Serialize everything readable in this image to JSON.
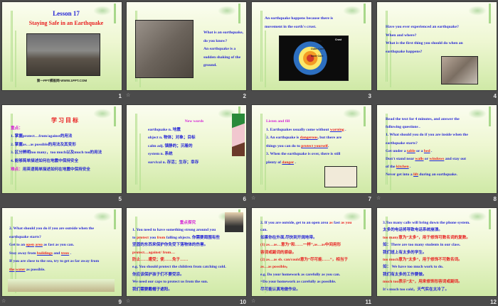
{
  "colors": {
    "blue": "#2626d6",
    "red": "#e82020",
    "magenta": "#d424d4",
    "dark": "#222222"
  },
  "slides": [
    {
      "number": "1",
      "lines": [
        {
          "align": "center",
          "size": 9,
          "segs": [
            {
              "t": "Lesson 17",
              "c": "blue"
            }
          ]
        },
        {
          "align": "center",
          "size": 8,
          "segs": [
            {
              "t": "Staying Safe  in an Earthquake",
              "c": "red"
            }
          ]
        }
      ],
      "footer": "第一PPT模板网-WWW.1PPT.COM",
      "image": "earthquake-ruins"
    },
    {
      "number": "2",
      "anim": true,
      "lines": [
        {
          "segs": [
            {
              "t": "What is an earthquake,",
              "c": "blue"
            }
          ]
        },
        {
          "segs": [
            {
              "t": "do you know?",
              "c": "blue"
            }
          ]
        },
        {
          "segs": [
            {
              "t": "An earthquake is a",
              "c": "blue"
            }
          ]
        },
        {
          "segs": [
            {
              "t": "sudden shaking of the",
              "c": "blue"
            }
          ]
        },
        {
          "segs": [
            {
              "t": "ground.",
              "c": "blue"
            }
          ]
        }
      ],
      "image": "collapsed-street"
    },
    {
      "number": "3",
      "lines": [
        {
          "segs": [
            {
              "t": "An earthquake happens because there is",
              "c": "blue"
            }
          ]
        },
        {
          "segs": [
            {
              "t": "movement in the earth's crust.",
              "c": "blue"
            }
          ]
        }
      ],
      "image": "earth-layers",
      "diagram_labels": [
        "Mantle",
        "Crust",
        "Outer Core",
        "Inner Core"
      ]
    },
    {
      "number": "4",
      "lines": [
        {
          "segs": [
            {
              "t": "Have you ever experienced an earthquake?",
              "c": "blue"
            }
          ]
        },
        {
          "segs": [
            {
              "t": "When and where?",
              "c": "blue"
            }
          ]
        },
        {
          "segs": [
            {
              "t": "What is the first thing you should do when an",
              "c": "blue"
            }
          ]
        },
        {
          "segs": [
            {
              "t": "earthquake happens?",
              "c": "blue"
            }
          ]
        }
      ],
      "image": "rescue-photo"
    },
    {
      "number": "5",
      "lines": [
        {
          "align": "center",
          "size": 8,
          "segs": [
            {
              "t": "学 习 目 标",
              "c": "red"
            }
          ]
        },
        {
          "segs": [
            {
              "t": "重点：",
              "c": "magenta"
            }
          ]
        },
        {
          "segs": [
            {
              "t": "1. 掌握protect…from/against的用法",
              "c": "blue"
            }
          ]
        },
        {
          "segs": [
            {
              "t": "2. 掌握as…as possible的用法及其变形",
              "c": "blue"
            }
          ]
        },
        {
          "segs": [
            {
              "t": "3. 区分辨明too many，too much以及much too的用法",
              "c": "blue"
            }
          ]
        },
        {
          "segs": [
            {
              "t": "4. 能够简单描述如何在地震中保持安全",
              "c": "blue"
            }
          ]
        },
        {
          "segs": [
            {
              "t": "难点：",
              "c": "magenta"
            },
            {
              "t": "用英语简单描述如何在地震中保持安全",
              "c": "blue"
            }
          ]
        }
      ]
    },
    {
      "number": "6",
      "lines": [
        {
          "align": "center",
          "segs": [
            {
              "t": "New  words",
              "c": "magenta"
            }
          ]
        },
        {
          "segs": [
            {
              "t": "earthquake                 n. 地震",
              "c": "blue"
            }
          ]
        },
        {
          "segs": [
            {
              "t": "object                  n. 物体；对象；目标",
              "c": "blue"
            }
          ]
        },
        {
          "segs": [
            {
              "t": "calm                    adj. 镇静的；沉着的",
              "c": "blue"
            }
          ]
        },
        {
          "segs": [
            {
              "t": "system                  n. 系统",
              "c": "blue"
            }
          ]
        },
        {
          "segs": [
            {
              "t": "survival                n. 存活；生存；幸存",
              "c": "blue"
            }
          ]
        }
      ],
      "image": "bird-branch"
    },
    {
      "number": "7",
      "anim": true,
      "lines": [
        {
          "segs": [
            {
              "t": "Listen  and  fill",
              "c": "magenta"
            }
          ]
        },
        {
          "segs": [
            {
              "t": "1. Earthquakes usually come without ",
              "c": "blue"
            },
            {
              "t": "warning",
              "c": "red",
              "u": true
            },
            {
              "t": " .",
              "c": "blue"
            }
          ]
        },
        {
          "segs": [
            {
              "t": "2. An earthquake is ",
              "c": "blue"
            },
            {
              "t": "dangerous",
              "c": "red",
              "u": true
            },
            {
              "t": ", but there are",
              "c": "blue"
            }
          ]
        },
        {
          "segs": [
            {
              "t": "things you can do to ",
              "c": "blue"
            },
            {
              "t": "protect  yourself",
              "c": "red",
              "u": true
            },
            {
              "t": ".",
              "c": "blue"
            }
          ]
        },
        {
          "segs": [
            {
              "t": "3. When the earthquake is over, there is still",
              "c": "blue"
            }
          ]
        },
        {
          "segs": [
            {
              "t": "plenty of ",
              "c": "blue"
            },
            {
              "t": "danger",
              "c": "red",
              "u": true
            },
            {
              "t": " .",
              "c": "blue"
            }
          ]
        }
      ],
      "image": "cartoon-kids"
    },
    {
      "number": "8",
      "anim": true,
      "lines": [
        {
          "segs": [
            {
              "t": "Read the text for 4 minutes, and answer the",
              "c": "blue"
            }
          ]
        },
        {
          "segs": [
            {
              "t": "following questions .",
              "c": "blue"
            }
          ]
        },
        {
          "segs": [
            {
              "t": "1. What should you do if you are inside when the",
              "c": "blue"
            }
          ]
        },
        {
          "segs": [
            {
              "t": "earthquake starts?",
              "c": "blue"
            }
          ]
        },
        {
          "segs": [
            {
              "t": "Get under a ",
              "c": "blue"
            },
            {
              "t": "table",
              "c": "red",
              "u": true
            },
            {
              "t": " or a ",
              "c": "blue"
            },
            {
              "t": "bed",
              "c": "red",
              "u": true
            },
            {
              "t": " .",
              "c": "blue"
            }
          ]
        },
        {
          "segs": [
            {
              "t": "Don't stand near ",
              "c": "blue"
            },
            {
              "t": "walls",
              "c": "red",
              "u": true
            },
            {
              "t": "  or ",
              "c": "blue"
            },
            {
              "t": "windows",
              "c": "red",
              "u": true
            },
            {
              "t": " and stay out",
              "c": "blue"
            }
          ]
        },
        {
          "segs": [
            {
              "t": "of the ",
              "c": "blue"
            },
            {
              "t": "kitchen",
              "c": "red",
              "u": true
            },
            {
              "t": " .",
              "c": "blue"
            }
          ]
        },
        {
          "segs": [
            {
              "t": "Never get into a ",
              "c": "blue"
            },
            {
              "t": "lift",
              "c": "red",
              "u": true
            },
            {
              "t": "  during an earthquake.",
              "c": "blue"
            }
          ]
        }
      ]
    },
    {
      "number": "9",
      "anim": true,
      "lines": [
        {
          "segs": [
            {
              "t": "2. What should you do if you are outside when the",
              "c": "blue"
            }
          ]
        },
        {
          "segs": [
            {
              "t": "earthquake starts?",
              "c": "blue"
            }
          ]
        },
        {
          "segs": [
            {
              "t": "Get to an ",
              "c": "blue"
            },
            {
              "t": "open",
              "c": "red",
              "u": true
            },
            {
              "t": "  ",
              "c": "blue"
            },
            {
              "t": "area",
              "c": "red",
              "u": true
            },
            {
              "t": "  as fast as you can.",
              "c": "blue"
            }
          ]
        },
        {
          "segs": [
            {
              "t": "Stay away from ",
              "c": "blue"
            },
            {
              "t": "buildings",
              "c": "red",
              "u": true
            },
            {
              "t": " and ",
              "c": "blue"
            },
            {
              "t": "trees",
              "c": "red",
              "u": true
            },
            {
              "t": " .",
              "c": "blue"
            }
          ]
        },
        {
          "segs": [
            {
              "t": "If you are close to the sea, try to get as far away from",
              "c": "blue"
            }
          ]
        },
        {
          "segs": [
            {
              "t": "the",
              "c": "red",
              "u": true
            },
            {
              "t": "  ",
              "c": "blue"
            },
            {
              "t": "water",
              "c": "red",
              "u": true
            },
            {
              "t": " as possible.",
              "c": "blue"
            }
          ]
        }
      ],
      "image": "landscape-strip"
    },
    {
      "number": "10",
      "anim": true,
      "lines": [
        {
          "align": "center",
          "segs": [
            {
              "t": "重点探究",
              "c": "magenta"
            }
          ]
        },
        {
          "segs": [
            {
              "t": "1. You need to have something strong around you",
              "c": "blue"
            }
          ]
        },
        {
          "segs": [
            {
              "t": "to ",
              "c": "blue"
            },
            {
              "t": "protect",
              "c": "red"
            },
            {
              "t": " you ",
              "c": "blue"
            },
            {
              "t": "from",
              "c": "red"
            },
            {
              "t": " falling objects. 你需要周围有些",
              "c": "blue"
            }
          ]
        },
        {
          "segs": [
            {
              "t": "坚固的东西来保护你免受下落物体的伤害。",
              "c": "blue"
            }
          ]
        },
        {
          "segs": [
            {
              "t": "protect…against/ from…",
              "c": "red"
            }
          ]
        },
        {
          "segs": [
            {
              "t": "防止……遭受；使……免于……",
              "c": "red"
            }
          ]
        },
        {
          "segs": [
            {
              "t": "e.g. You should protect the children from catching cold.",
              "c": "blue"
            }
          ]
        },
        {
          "segs": [
            {
              "t": "你应该保护孩子们不要受凉。",
              "c": "blue"
            }
          ]
        },
        {
          "segs": [
            {
              "t": "  We need our caps to protect us from the sun.",
              "c": "blue"
            }
          ]
        },
        {
          "segs": [
            {
              "t": "    我们需要戴帽子遮阳。",
              "c": "blue"
            }
          ]
        }
      ],
      "image": "cartoon-teacher"
    },
    {
      "number": "11",
      "anim": true,
      "lines": [
        {
          "segs": [
            {
              "t": "2. If you are outside, get to an open area ",
              "c": "blue"
            },
            {
              "t": "as",
              "c": "red"
            },
            {
              "t": " fast ",
              "c": "blue"
            },
            {
              "t": "as you",
              "c": "red"
            }
          ]
        },
        {
          "segs": [
            {
              "t": "can.",
              "c": "blue"
            }
          ]
        },
        {
          "segs": [
            {
              "t": "如果你在外面,尽快到开阔地带。",
              "c": "blue"
            }
          ]
        },
        {
          "segs": [
            {
              "t": "(1) as…as…意为“和……一样”,as…as中间用形",
              "c": "red"
            }
          ]
        },
        {
          "segs": [
            {
              "t": "容词或副词的原级。",
              "c": "red"
            }
          ]
        },
        {
          "segs": [
            {
              "t": "(2) as…as sb. can/could意为“尽可能……”，相当于",
              "c": "red"
            }
          ]
        },
        {
          "segs": [
            {
              "t": "as…as possible。",
              "c": "red"
            }
          ]
        },
        {
          "segs": [
            {
              "t": "e.g. Do your homework as carefully as you can.",
              "c": "blue"
            }
          ]
        },
        {
          "segs": [
            {
              "t": "  =Do your homework as carefully as possible.",
              "c": "blue"
            }
          ]
        },
        {
          "segs": [
            {
              "t": "   尽可能认真地做作业。",
              "c": "blue"
            }
          ]
        }
      ]
    },
    {
      "number": "12",
      "lines": [
        {
          "segs": [
            {
              "t": "3.Too many calls will bring down the phone system.",
              "c": "blue"
            }
          ]
        },
        {
          "segs": [
            {
              "t": "太多的电话将导致电话系统崩溃。",
              "c": "blue"
            }
          ]
        },
        {
          "segs": [
            {
              "t": "too many意为“太多”，用于修饰可数名词的复数。",
              "c": "red"
            }
          ]
        },
        {
          "segs": [
            {
              "t": "如：There are too many students in our class.",
              "c": "blue"
            }
          ]
        },
        {
          "segs": [
            {
              "t": "      我们班上有太多的学生。",
              "c": "blue"
            }
          ]
        },
        {
          "segs": [
            {
              "t": "too much意为“太多”，用于修饰不可数名词。",
              "c": "red"
            }
          ]
        },
        {
          "segs": [
            {
              "t": "如：  We have too much work to do.",
              "c": "blue"
            }
          ]
        },
        {
          "segs": [
            {
              "t": "      我们有太多的工作要做。",
              "c": "blue"
            }
          ]
        },
        {
          "segs": [
            {
              "t": "much too表示“太”，用来修饰形容词或副词。",
              "c": "red"
            }
          ]
        },
        {
          "segs": [
            {
              "t": "It's much too cold，天气实在太冷了。",
              "c": "blue"
            }
          ]
        }
      ]
    }
  ]
}
